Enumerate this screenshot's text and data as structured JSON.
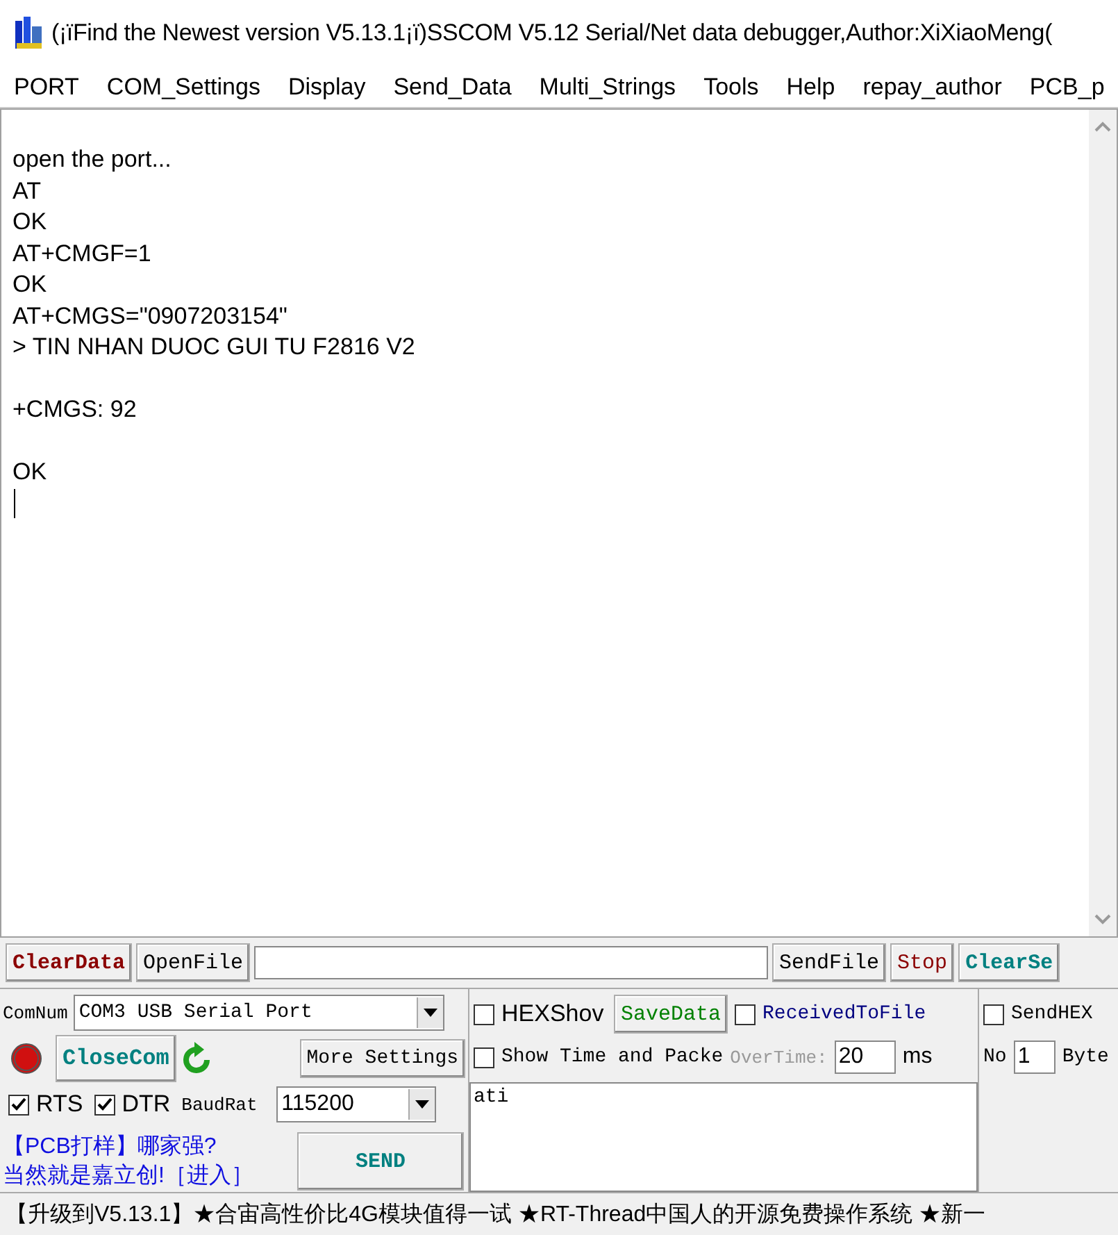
{
  "window": {
    "title": "(¡ïFind the Newest version V5.13.1¡ï)SSCOM V5.12 Serial/Net data debugger,Author:XiXiaoMeng("
  },
  "menu": [
    "PORT",
    "COM_Settings",
    "Display",
    "Send_Data",
    "Multi_Strings",
    "Tools",
    "Help",
    "repay_author",
    "PCB_p"
  ],
  "receive": {
    "text": "open the port...\nAT\nOK\nAT+CMGF=1\nOK\nAT+CMGS=\"0907203154\"\n> TIN NHAN DUOC GUI TU F2816 V2\n\n+CMGS: 92\n\nOK"
  },
  "file_row": {
    "clear_button": "ClearData",
    "open_button": "OpenFile",
    "send_file_button": "SendFile",
    "stop_button": "Stop",
    "clear_send_button": "ClearSe"
  },
  "port": {
    "label": "ComNum",
    "value": "COM3 USB Serial Port",
    "close_button": "CloseCom",
    "more_button": "More Settings",
    "open": true,
    "rts": {
      "label": "RTS",
      "checked": true
    },
    "dtr": {
      "label": "DTR",
      "checked": true
    },
    "baud_label": "BaudRat",
    "baud": "115200"
  },
  "ad": {
    "line1": "【PCB打样】哪家强?",
    "line2": "当然就是嘉立创!［进入］"
  },
  "send_button": "SEND",
  "options": {
    "hex_show": {
      "label": "HEXShov",
      "checked": false
    },
    "save_button": "SaveData",
    "received_to_file": {
      "label": "ReceivedToFile",
      "checked": false
    },
    "show_time": {
      "label": "Show Time and Packe",
      "checked": false
    },
    "overtime_label": "OverTime:",
    "overtime": "20",
    "ms": "ms"
  },
  "send_options": {
    "send_hex": {
      "label": "SendHEX",
      "checked": false
    },
    "no_label": "No",
    "no_value": "1",
    "byte_label": "Byte"
  },
  "send_text": "ati",
  "status_bar": "【升级到V5.13.1】★合宙高性价比4G模块值得一试 ★RT-Thread中国人的开源免费操作系统 ★新一"
}
